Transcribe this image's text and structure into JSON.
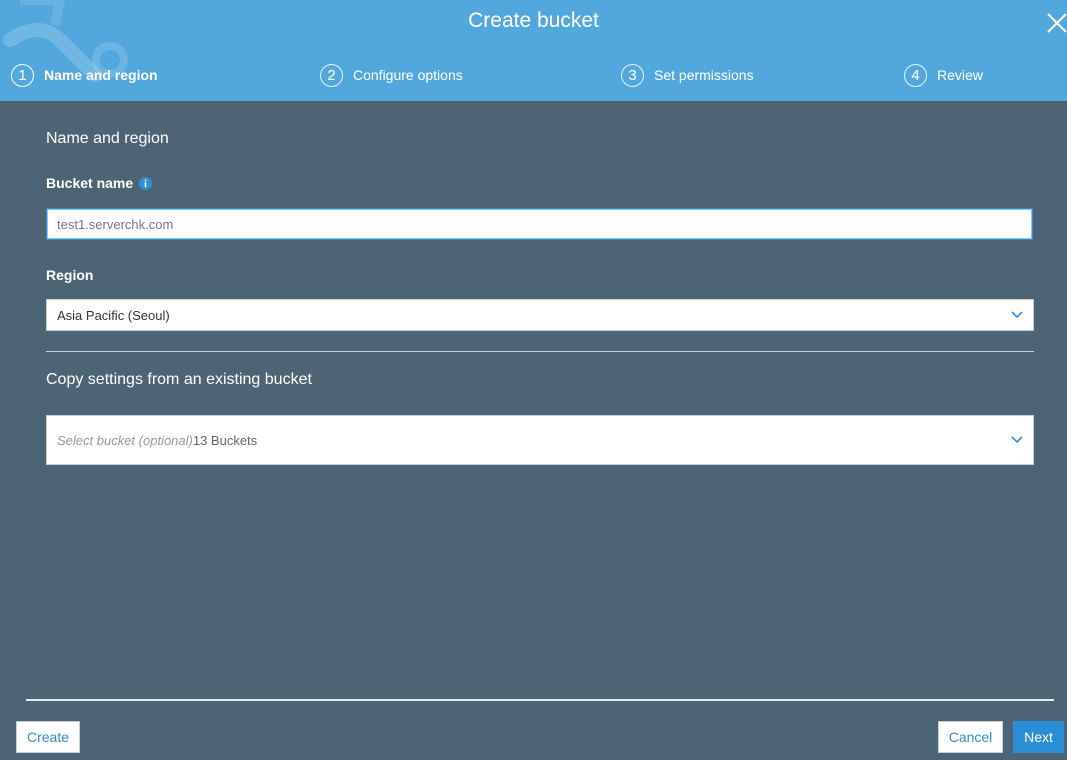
{
  "header": {
    "title": "Create bucket",
    "steps": [
      {
        "number": "1",
        "label": "Name and region",
        "active": true
      },
      {
        "number": "2",
        "label": "Configure options",
        "active": false
      },
      {
        "number": "3",
        "label": "Set permissions",
        "active": false
      },
      {
        "number": "4",
        "label": "Review",
        "active": false
      }
    ],
    "close_icon": "close-icon"
  },
  "form": {
    "section_title": "Name and region",
    "bucket_name_label": "Bucket name",
    "bucket_name_value": "test1.serverchk.com",
    "region_label": "Region",
    "region_value": "Asia Pacific (Seoul)",
    "copy_section_title": "Copy settings from an existing bucket",
    "copy_placeholder": "Select bucket (optional)",
    "copy_count": "13 Buckets"
  },
  "footer": {
    "create_label": "Create",
    "cancel_label": "Cancel",
    "next_label": "Next"
  },
  "colors": {
    "header_bg": "#52a8dd",
    "body_bg": "#4d6474",
    "accent": "#2a8ed6"
  }
}
